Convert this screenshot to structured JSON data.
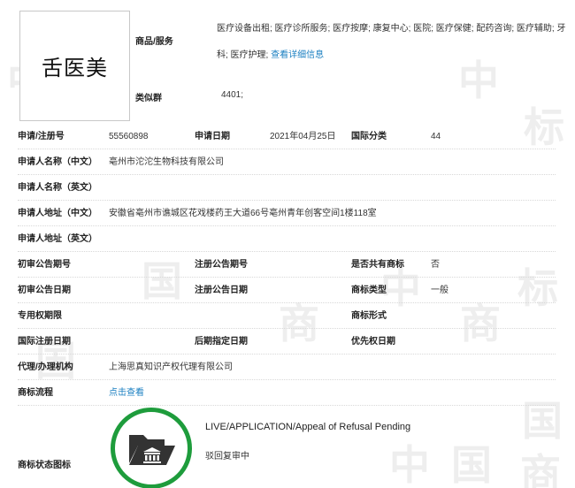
{
  "logo": {
    "text": "舌医美"
  },
  "goods_services": {
    "label": "商品/服务",
    "text": "医疗设备出租; 医疗诊所服务; 医疗按摩; 康复中心; 医院; 医疗保健; 配药咨询; 医疗辅助; 牙科; 医疗护理;",
    "link": "查看详细信息"
  },
  "similar_group": {
    "label": "类似群",
    "value": "4401;"
  },
  "rows": {
    "reg_no": {
      "label": "申请/注册号",
      "value": "55560898"
    },
    "app_date": {
      "label": "申请日期",
      "value": "2021年04月25日"
    },
    "intl_class": {
      "label": "国际分类",
      "value": "44"
    },
    "applicant_cn": {
      "label": "申请人名称（中文）",
      "value": "亳州市沱沱生物科技有限公司"
    },
    "applicant_en": {
      "label": "申请人名称（英文）",
      "value": ""
    },
    "address_cn": {
      "label": "申请人地址（中文）",
      "value": "安徽省亳州市谯城区花戏楼药王大道66号亳州青年创客空间1楼118室"
    },
    "address_en": {
      "label": "申请人地址（英文）",
      "value": ""
    },
    "prelim_pub_no": {
      "label": "初审公告期号"
    },
    "reg_pub_no": {
      "label": "注册公告期号"
    },
    "shared": {
      "label": "是否共有商标",
      "value": "否"
    },
    "prelim_pub_date": {
      "label": "初审公告日期"
    },
    "reg_pub_date": {
      "label": "注册公告日期"
    },
    "mark_type": {
      "label": "商标类型",
      "value": "一般"
    },
    "exclusive_period": {
      "label": "专用权期限"
    },
    "mark_form": {
      "label": "商标形式"
    },
    "intl_reg_date": {
      "label": "国际注册日期"
    },
    "later_date": {
      "label": "后期指定日期"
    },
    "priority_date": {
      "label": "优先权日期"
    },
    "agent": {
      "label": "代理/办理机构",
      "value": "上海思真知识产权代理有限公司"
    },
    "process": {
      "label": "商标流程",
      "link": "点击查看"
    },
    "status_icon": {
      "label": "商标状态图标"
    }
  },
  "status": {
    "en": "LIVE/APPLICATION/Appeal of Refusal Pending",
    "cn": "驳回复审中",
    "icon": "folder-courthouse-icon",
    "ring_color": "#1e9c3c"
  },
  "watermark": {
    "chars": [
      "中",
      "国",
      "商",
      "标"
    ],
    "color": "#eeeeee"
  },
  "colors": {
    "link": "#1a7fc1"
  }
}
